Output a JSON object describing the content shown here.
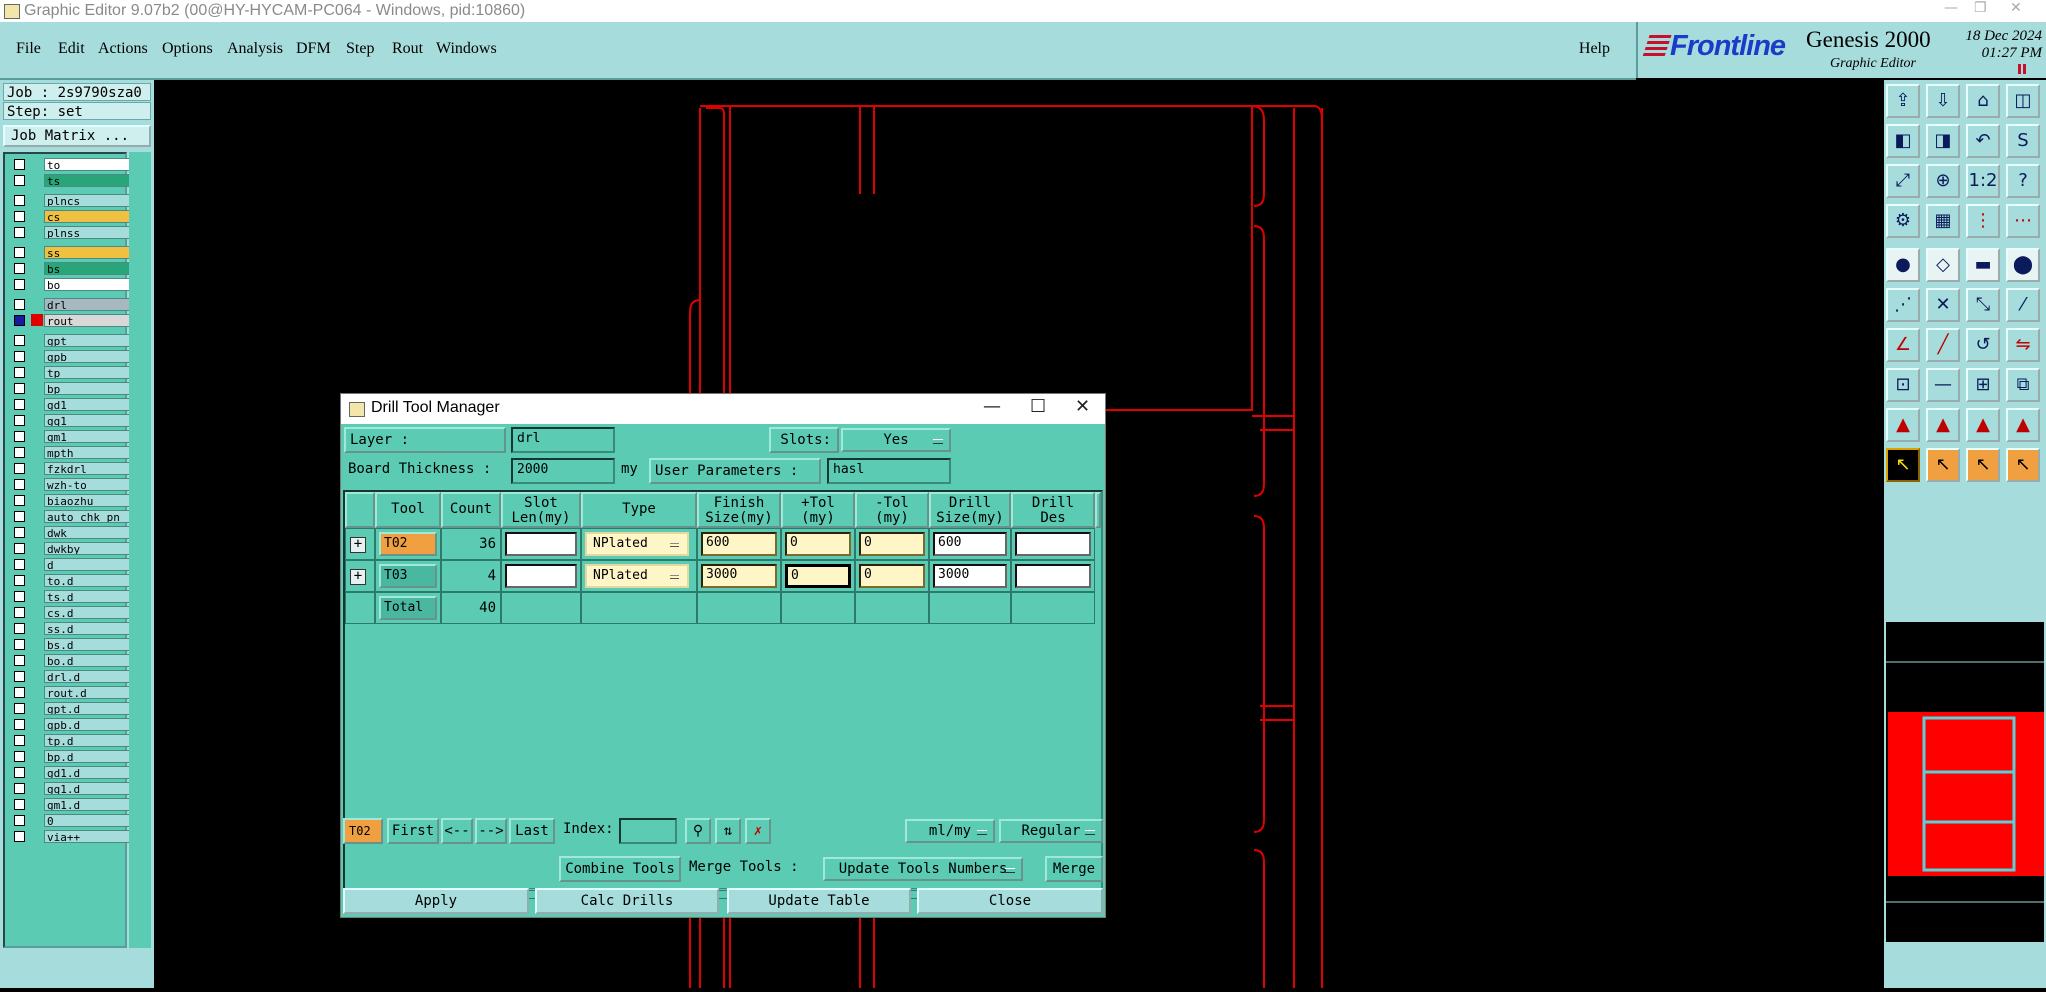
{
  "window": {
    "title": "Graphic Editor 9.07b2 (00@HY-HYCAM-PC064 - Windows, pid:10860)"
  },
  "menu": [
    "File",
    "Edit",
    "Actions",
    "Options",
    "Analysis",
    "DFM",
    "Step",
    "Rout",
    "Windows"
  ],
  "help_label": "Help",
  "brand": {
    "logo": "Frontline",
    "product": "Genesis 2000",
    "subtitle": "Graphic Editor",
    "date": "18 Dec 2024",
    "time": "01:27  PM"
  },
  "job": {
    "job_line": "Job : 2s9790sza0",
    "step_line": "Step: set",
    "matrix_button": "Job Matrix ..."
  },
  "layers": [
    {
      "name": "to",
      "color": "#ffffff"
    },
    {
      "name": "ts",
      "color": "#2aa57a"
    },
    {
      "name": "plncs",
      "color": "#a6dcdc"
    },
    {
      "name": "cs",
      "color": "#f0c040"
    },
    {
      "name": "plnss",
      "color": "#a6dcdc"
    },
    {
      "name": "ss",
      "color": "#f0c040"
    },
    {
      "name": "bs",
      "color": "#2aa57a"
    },
    {
      "name": "bo",
      "color": "#ffffff"
    },
    {
      "name": "drl",
      "color": "#a8b8c0"
    },
    {
      "name": "rout",
      "color": "#d8d8d8"
    },
    {
      "name": "gpt",
      "color": "#a6dcdc"
    },
    {
      "name": "gpb",
      "color": "#a6dcdc"
    },
    {
      "name": "tp",
      "color": "#a6dcdc"
    },
    {
      "name": "bp",
      "color": "#a6dcdc"
    },
    {
      "name": "gd1",
      "color": "#a6dcdc"
    },
    {
      "name": "gg1",
      "color": "#a6dcdc"
    },
    {
      "name": "gm1",
      "color": "#a6dcdc"
    },
    {
      "name": "mpth",
      "color": "#a6dcdc"
    },
    {
      "name": "fzkdrl",
      "color": "#a6dcdc"
    },
    {
      "name": "wzh-to",
      "color": "#a6dcdc"
    },
    {
      "name": "biaozhu",
      "color": "#a6dcdc"
    },
    {
      "name": "auto_chk_pn",
      "color": "#a6dcdc"
    },
    {
      "name": "dwk",
      "color": "#a6dcdc"
    },
    {
      "name": "dwkby",
      "color": "#a6dcdc"
    },
    {
      "name": "d",
      "color": "#a6dcdc"
    },
    {
      "name": "to.d",
      "color": "#a6dcdc"
    },
    {
      "name": "ts.d",
      "color": "#a6dcdc"
    },
    {
      "name": "cs.d",
      "color": "#a6dcdc"
    },
    {
      "name": "ss.d",
      "color": "#a6dcdc"
    },
    {
      "name": "bs.d",
      "color": "#a6dcdc"
    },
    {
      "name": "bo.d",
      "color": "#a6dcdc"
    },
    {
      "name": "drl.d",
      "color": "#a6dcdc"
    },
    {
      "name": "rout.d",
      "color": "#a6dcdc"
    },
    {
      "name": "gpt.d",
      "color": "#a6dcdc"
    },
    {
      "name": "gpb.d",
      "color": "#a6dcdc"
    },
    {
      "name": "tp.d",
      "color": "#a6dcdc"
    },
    {
      "name": "bp.d",
      "color": "#a6dcdc"
    },
    {
      "name": "gd1.d",
      "color": "#a6dcdc"
    },
    {
      "name": "gg1.d",
      "color": "#a6dcdc"
    },
    {
      "name": "gm1.d",
      "color": "#a6dcdc"
    },
    {
      "name": "0",
      "color": "#a6dcdc"
    },
    {
      "name": "via++",
      "color": "#a6dcdc"
    }
  ],
  "dialog": {
    "title": "Drill Tool Manager",
    "layer_label": "Layer        :",
    "layer_value": "drl",
    "slots_label": "Slots:",
    "slots_value": "Yes",
    "board_thickness_label": "Board Thickness :",
    "board_thickness_value": "2000",
    "board_thickness_unit": "my",
    "user_params_label": "User Parameters :",
    "user_params_value": "hasl",
    "columns": [
      {
        "l1": "Tool",
        "l2": ""
      },
      {
        "l1": "Count",
        "l2": ""
      },
      {
        "l1": "Slot",
        "l2": "Len(my)"
      },
      {
        "l1": "Type",
        "l2": ""
      },
      {
        "l1": "Finish",
        "l2": "Size(my)"
      },
      {
        "l1": "+Tol",
        "l2": "(my)"
      },
      {
        "l1": "-Tol",
        "l2": "(my)"
      },
      {
        "l1": "Drill",
        "l2": "Size(my)"
      },
      {
        "l1": "Drill",
        "l2": "Des"
      }
    ],
    "rows": [
      {
        "tool": "T02",
        "count": "36",
        "slot_len": "",
        "type": "NPlated",
        "finish": "600",
        "plus_tol": "0",
        "minus_tol": "0",
        "drill_size": "600",
        "drill_des": ""
      },
      {
        "tool": "T03",
        "count": "4",
        "slot_len": "",
        "type": "NPlated",
        "finish": "3000",
        "plus_tol": "0",
        "minus_tol": "0",
        "drill_size": "3000",
        "drill_des": ""
      }
    ],
    "total_label": "Total",
    "total_count": "40",
    "nav": {
      "current": "T02",
      "first": "First",
      "prev": "<--",
      "next": "-->",
      "last": "Last",
      "index_label": "Index:",
      "index_value": "",
      "units": "ml/my",
      "mode": "Regular"
    },
    "combine_tools": "Combine Tools",
    "merge_tools_label": "Merge Tools :",
    "merge_option": "Update Tools Numbers",
    "merge_button": "Merge",
    "apply": "Apply",
    "calc_drills": "Calc Drills",
    "update_table": "Update Table",
    "close": "Close"
  },
  "toolbar_icons": [
    "open-job-icon",
    "save-icon",
    "home-icon",
    "windows-icon",
    "prev-step-icon",
    "next-step-icon",
    "undo-icon",
    "snap-icon",
    "zoom-fit-icon",
    "zoom-icon",
    "scale-icon",
    "help-icon",
    "measure-icon",
    "grid-icon",
    "layers-icon",
    "drill-icon",
    "pad-icon",
    "polygon-icon",
    "line-icon",
    "circle-icon",
    "select-icon",
    "cross-icon",
    "route-icon",
    "arc-icon",
    "angle-icon",
    "slash-icon",
    "rotate-icon",
    "mirror-icon",
    "copy-icon",
    "move-icon",
    "align-icon",
    "group-icon",
    "tri-icon",
    "tri2-icon",
    "tri3-icon",
    "tri4-icon",
    "pointer-icon",
    "pointer2-icon",
    "pointer3-icon",
    "pointer4-icon"
  ],
  "colors": {
    "panel": "#a6dcdc",
    "dialog": "#5bcbb4",
    "outline": "#e00000",
    "highlight": "#f0a040"
  }
}
